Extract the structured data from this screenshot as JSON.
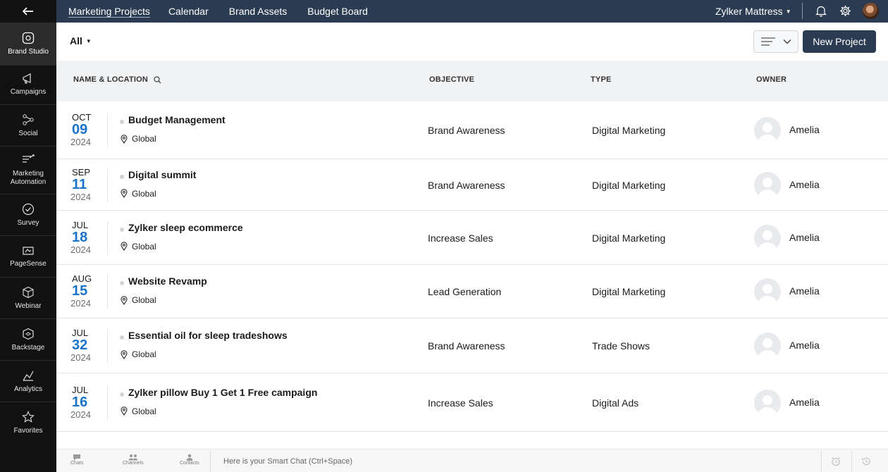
{
  "sidebar": {
    "back_icon": "back-arrow-icon",
    "items": [
      {
        "label": "Brand Studio",
        "icon": "brand-studio-icon",
        "active": true
      },
      {
        "label": "Campaigns",
        "icon": "megaphone-icon"
      },
      {
        "label": "Social",
        "icon": "share-icon"
      },
      {
        "label": "Marketing Automation",
        "icon": "automation-icon"
      },
      {
        "label": "Survey",
        "icon": "check-circle-icon"
      },
      {
        "label": "PageSense",
        "icon": "pagesense-icon"
      },
      {
        "label": "Webinar",
        "icon": "webinar-icon"
      },
      {
        "label": "Backstage",
        "icon": "backstage-icon"
      },
      {
        "label": "Analytics",
        "icon": "analytics-icon"
      },
      {
        "label": "Favorites",
        "icon": "star-icon"
      }
    ]
  },
  "topbar": {
    "tabs": [
      "Marketing Projects",
      "Calendar",
      "Brand Assets",
      "Budget Board"
    ],
    "active_tab": "Marketing Projects",
    "org_name": "Zylker Mattress",
    "icons": [
      "bell-icon",
      "gear-icon",
      "user-avatar"
    ]
  },
  "toolbar": {
    "filter_label": "All",
    "new_button_label": "New Project"
  },
  "table": {
    "headers": {
      "name": "NAME & LOCATION",
      "objective": "OBJECTIVE",
      "type": "TYPE",
      "owner": "OWNER"
    },
    "rows": [
      {
        "month": "OCT",
        "day": "09",
        "year": "2024",
        "name": "Budget Management",
        "location": "Global",
        "objective": "Brand Awareness",
        "type": "Digital Marketing",
        "owner": "Amelia"
      },
      {
        "month": "SEP",
        "day": "11",
        "year": "2024",
        "name": "Digital summit",
        "location": "Global",
        "objective": "Brand Awareness",
        "type": "Digital Marketing",
        "owner": "Amelia"
      },
      {
        "month": "JUL",
        "day": "18",
        "year": "2024",
        "name": "Zylker sleep ecommerce",
        "location": "Global",
        "objective": "Increase Sales",
        "type": "Digital Marketing",
        "owner": "Amelia"
      },
      {
        "month": "AUG",
        "day": "15",
        "year": "2024",
        "name": "Website Revamp",
        "location": "Global",
        "objective": "Lead Generation",
        "type": "Digital Marketing",
        "owner": "Amelia"
      },
      {
        "month": "JUL",
        "day": "32",
        "year": "2024",
        "name": "Essential oil for sleep tradeshows",
        "location": "Global",
        "objective": "Brand Awareness",
        "type": "Trade Shows",
        "owner": "Amelia"
      },
      {
        "month": "JUL",
        "day": "16",
        "year": "2024",
        "name": "Zylker pillow Buy 1 Get 1 Free campaign",
        "location": "Global",
        "objective": "Increase Sales",
        "type": "Digital Ads",
        "owner": "Amelia"
      }
    ]
  },
  "bottombar": {
    "items": [
      "Chats",
      "Channels",
      "Contacts"
    ],
    "smart_chat_placeholder": "Here is your Smart Chat (Ctrl+Space)"
  },
  "colors": {
    "topbar_bg": "#2b3c52",
    "sidebar_bg": "#111111",
    "accent_blue": "#1a73c8",
    "primary_button": "#2b3c52"
  }
}
